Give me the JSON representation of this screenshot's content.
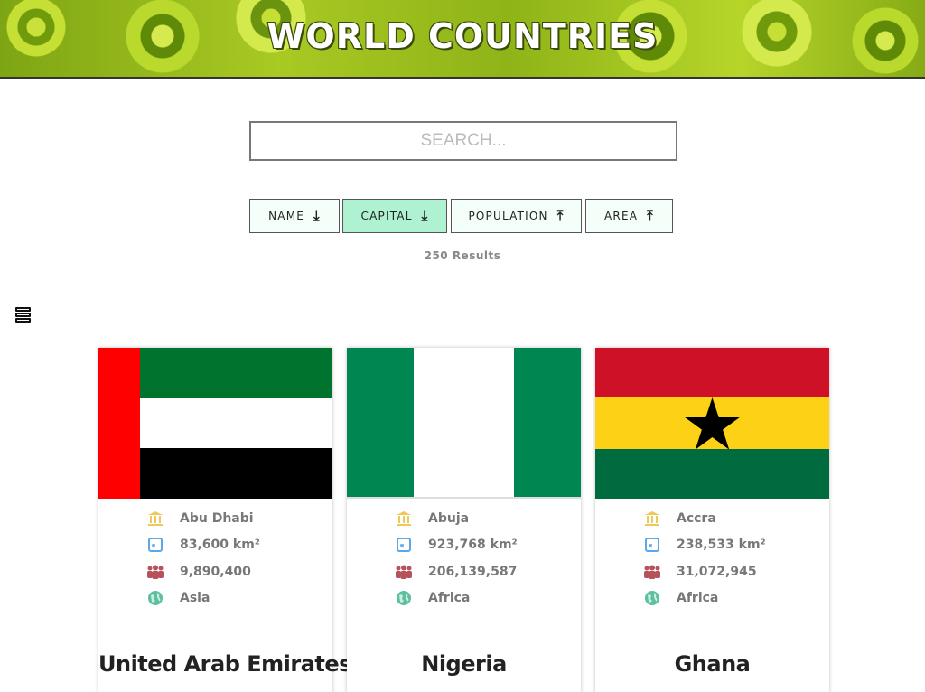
{
  "header": {
    "title": "WORLD COUNTRIES"
  },
  "search": {
    "placeholder": "SEARCH..."
  },
  "sort_buttons": [
    {
      "label": "NAME",
      "direction": "down",
      "active": false
    },
    {
      "label": "CAPITAL",
      "direction": "down",
      "active": true
    },
    {
      "label": "POPULATION",
      "direction": "up",
      "active": false
    },
    {
      "label": "AREA",
      "direction": "up",
      "active": false
    }
  ],
  "results": {
    "text": "250 Results"
  },
  "icons": {
    "view_toggle": "list-view-icon",
    "capital": "building-icon",
    "area": "area-icon",
    "population": "population-icon",
    "region": "globe-icon"
  },
  "colors": {
    "active_sort": "#aef2d2",
    "sort_bg": "#f4fff9"
  },
  "countries": [
    {
      "name": "United Arab Emirates",
      "capital": "Abu Dhabi",
      "area": "83,600 km²",
      "population": "9,890,400",
      "region": "Asia"
    },
    {
      "name": "Nigeria",
      "capital": "Abuja",
      "area": "923,768 km²",
      "population": "206,139,587",
      "region": "Africa"
    },
    {
      "name": "Ghana",
      "capital": "Accra",
      "area": "238,533 km²",
      "population": "31,072,945",
      "region": "Africa"
    }
  ]
}
